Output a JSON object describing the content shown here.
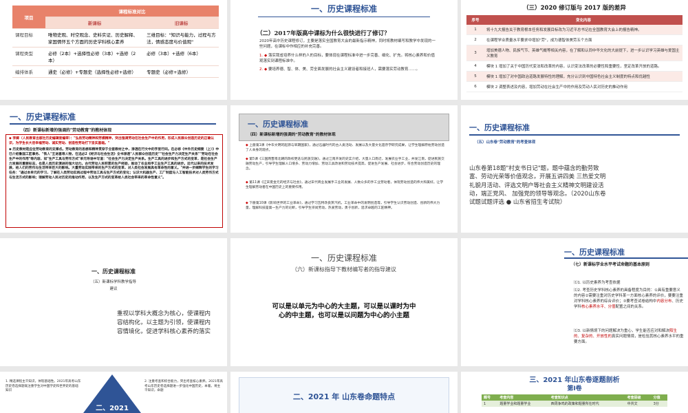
{
  "s1": {
    "col_item": "项目",
    "col_compare": "课程标准对比",
    "col_new": "新课标",
    "col_old": "旧课标",
    "rows": [
      {
        "label": "课程目标",
        "new": "唯物史观、时空观念、史料实证、历史解释、家国情怀五个方面的历史学科核心素养",
        "old": "三维目标：\"知识与能力，过程与方法，情感态度与价值观\""
      },
      {
        "label": "课程类型",
        "new": "必修（2本）+选择性必修（3本）+选修（2本）",
        "old": "必修（3本）+选修（6本）"
      },
      {
        "label": "编排体系",
        "new": "通史（必修）+专题史（选择性必修+选修）",
        "old": "专题史（必修+选修）"
      }
    ]
  },
  "s2": {
    "title": "一、历史课程标准",
    "subtitle": "（二）2017年版高中课标为什么很快进行了修订？",
    "para": "2020年高中历史课程修订，主要是落实全国教育大会的最新指示精神，同时将教材编写和教学中发现的一些问题，在课标中作相应的补充完善。",
    "b1": "落实我省培养什么样的人的目标，要体现在课程标准中进一步完善、细化、扩充。将核心素养和价值观落实到课程标准中。",
    "b2": "要培养德、智、体、美、劳全面发展的社会主义建设者和接班人，需要落实劳动教育……。"
  },
  "s3": {
    "title": "（三）2020 修订版与 2017 版的差异",
    "h_no": "序号",
    "h_content": "变化内容",
    "rows": [
      {
        "no": "1",
        "text": "将十九大报告关于教育根本任务和发展目标改为习近平总书记在全国教育大会上的报告精神。"
      },
      {
        "no": "2",
        "text": "在课程学业质量水平要求中增加\"劳\"，成为德智体美劳五个方面"
      },
      {
        "no": "3",
        "text": "增加美德人物、民族气节、英雄气概等相关内容，在了解和认同中华文化的大前提下，进一步认识学习英雄与爱国主义教育"
      },
      {
        "no": "4",
        "text": "模块 1 增加了关于中国历代变法和改革的内容，认识变法改革的必要性和重要性，坚定改革开放的道路。"
      },
      {
        "no": "5",
        "text": "模块 1 增加了对中国政治道路发展特性的理解，充分认识到中国特色社会主义制度的特点和优越性"
      },
      {
        "no": "6",
        "text": "模块 2 调整表述及内容，增加劳动在社会生产中的作用及劳动人民对历史的推动作用"
      }
    ]
  },
  "s4": {
    "title": "一、历史课程标准",
    "subtitle": "（四）新课标新增的强调的\"劳动教育\"的教材体现",
    "red": "李卿（人民教育出版社历史编辑室编审）：\"弘扬劳动精神和劳模精神，突出强调劳动在社会生产中的作用，形成人民群众创造历史的正确认识，为学生长大后幸福劳动、诚实劳动、创造性劳动打下坚实基础。\"",
    "body": "历史教材是应位劳动教育的支撑点。劳动教育的思想和精神贯穿于全套教材之中，渗透在行文中的字里行间。在必修《中外历史纲要（上）》中已介绍鲁国工匠事务、\"铁人\"王进喜等人物，在选必2《经济与社会生活》全书渗透\"人民群众创造历史\"\"社会生产力决定生产关系\"\"劳动在社会生产中的作用\"等内容，如\"生产工具与劳作方式\"单元导语中写道：\"社会生产力决定生产关系。生产工具的进步和生产方式的变革，是社会生产力发展的重要标志，也是人类历史演进的强大动力。古代劳动人民积累的生产经验，推动了农业和手工业生产工具的进步。近代以来的技术发展，给人们的劳作与生活带来巨大的影响。大量劳动实践带来的生产方式的变革，对人类社会发展具有革命性的意义。\"并进一步阐释学生的学习任务：\"通过本单元的学习，了解在人类劳动实践过程中劳动工具与生产方式的变化；认识大机器生产、工厂制度与人工智能技术对人类劳作方式与生活方式的影响；理解劳动人民对历史的推动作用，以及生产方式的变革给人类社会带来的革命性意义\"。"
  },
  "s5": {
    "title": "一、历史课程标准",
    "subtitle": "（四）新课标新增的强调的\"劳动教育\"的教材体现",
    "p1": "上册第1课《中华文明的起源与早期国家》，通过石器时代的古人类活动、发展以及大量文化遗存学研究成果，让学生理解原始劳动创造了人本身的观点。",
    "p2": "第5课《三国两晋南北朝的政权更迭与民族交融》，通过江南开发的史实介绍，大量人口南迁，发展农业手工业，并发江南，促进民族交融劳动生产，引导学生理解人口增多、劳动力增加、劳动工具改进和劳动技术提高，促进生产发展、社会进步，符合劳动创造历史的理念。",
    "p3": "第11课《辽宋夏金元的经济与社会》，通过宋代商业发展手工业的发展、人数众多的手工业劳动者，体现劳动创造的伟大和美好。让学生理解劳动者在中国历史上的重要作用。",
    "p4": "下册第10课《影响世界的工业革命》，通过学习瓦特改良蒸汽机，工业革命中的发明创造等，引导学生认识劳动创造、创新的伟大力量，理解科技是第一生产力的论断，引导学生崇尚劳动，热爱劳动，勇于创新，追求卓越的工匠精神。"
  },
  "s6": {
    "title": "一、历史课程标准",
    "subtitle": "（五）山东卷\"劳动教育\"的考查体现",
    "body": "山东卷第18题\"村支书日记\"题，题中蕴含的勤劳致富、劳动光荣等价值观念，开展五讲四美 三热爱文明礼貌月活动、评选文明户等社会主义精神文明建设活动，端正党风、 加强党的领导等观念。（2020山东卷试题试题评选 ● 山东省招生考试院）"
  },
  "s7": {
    "title": "一、历史课程标准",
    "subtitle": "（五）新课标学科教学指导",
    "subtitle2": "建议",
    "body": "重视以学科大概念为核心，使课程内容结构化，以主题为引领，使课程内容情境化，促进学科核心素养的落实"
  },
  "s8": {
    "title": "一、历史课程标准",
    "subtitle": "（六）新课标指导下教材编写者的指导建议",
    "body": "可以是以单元为中心的大主题，可以是以课时为中心的中主题，也可以是以问题为中心的小主题"
  },
  "s9": {
    "title": "一、历史课程标准",
    "subtitle": "（七）新课标学业水平考试命题的基本原则",
    "p1": "⑴1. 以历史素养为考查依据",
    "p2a": "⑴2. 考查历史学科核心素养的具备程度为目的：①具有重要意义的内容②需要注重对历史学科某一方面核心素养的评价，要要注重对学科核心素养的综合评价；③要考查试卷结构中",
    "p2h": "内容分布",
    "p2b": "、历史学科",
    "p2h2": "核心素养水平、分值",
    "p2c": "配置之间的关系。",
    "p3a": "⑴3. 以新情境下的问题解决为重心，学生能否应对和解决",
    "p3h": "陌生的、复杂的、开放性的",
    "p3b": "真实问题情境，是检验其核心素养水平的重要方面。"
  },
  "s10": {
    "badge": "二、2021",
    "left": "1. 精选课程主干知识，体现基础性。2021年高考山东历史卷选择题既注重学生对中国学史和世界史的基础知识",
    "right": "2. 注重考查和综合能力，突出考查核心素养。2021年高考山东历史卷选择题进一步强化中国历史，本着，将主干知识，命题"
  },
  "s11": {
    "title": "二、2021 年 山东卷命题特点"
  },
  "s12": {
    "title": "三、2021 年山东卷逐题剖析",
    "subtitle": "第Ⅰ卷",
    "headers": [
      "题号",
      "考查内容",
      "考查知识点",
      "考查层级",
      "分值"
    ],
    "row": [
      "1",
      "题量学业和题量学业",
      "西周争鸣的政策和题量所在时代",
      "中共文",
      "3分"
    ]
  }
}
